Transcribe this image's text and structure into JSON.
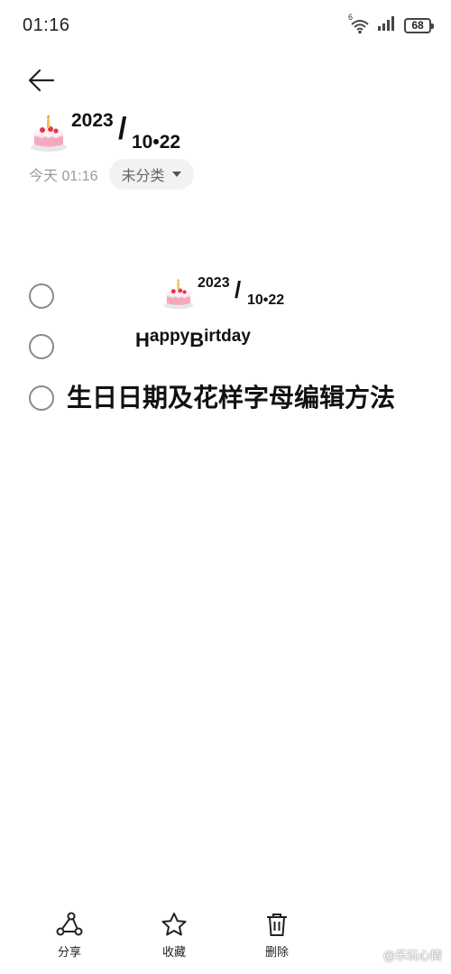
{
  "status_bar": {
    "time": "01:16",
    "signal_label": "6",
    "battery": "68"
  },
  "header": {
    "back_icon": "arrow-left-icon",
    "title": {
      "emoji": "🎂",
      "year": "2023",
      "slash": "/",
      "date": "10•22"
    },
    "meta_date": "今天 01:16",
    "category": "未分类"
  },
  "checklist": [
    {
      "emoji": "🎂",
      "year": "2023",
      "slash": "/",
      "date": "10•22",
      "checked": false
    },
    {
      "parts": [
        "H",
        "appy",
        "B",
        "irtday"
      ],
      "checked": false
    },
    {
      "text": "生日日期及花样字母编辑方法",
      "checked": false
    }
  ],
  "toolbar": {
    "share_label": "分享",
    "favorite_label": "收藏",
    "delete_label": "删除"
  },
  "watermark": "@乐玩心情",
  "colors": {
    "background": "#ffffff",
    "text": "#111111",
    "muted": "#9a9a9a",
    "chip_bg": "#f2f2f2",
    "checkbox": "#8a8a8a"
  }
}
